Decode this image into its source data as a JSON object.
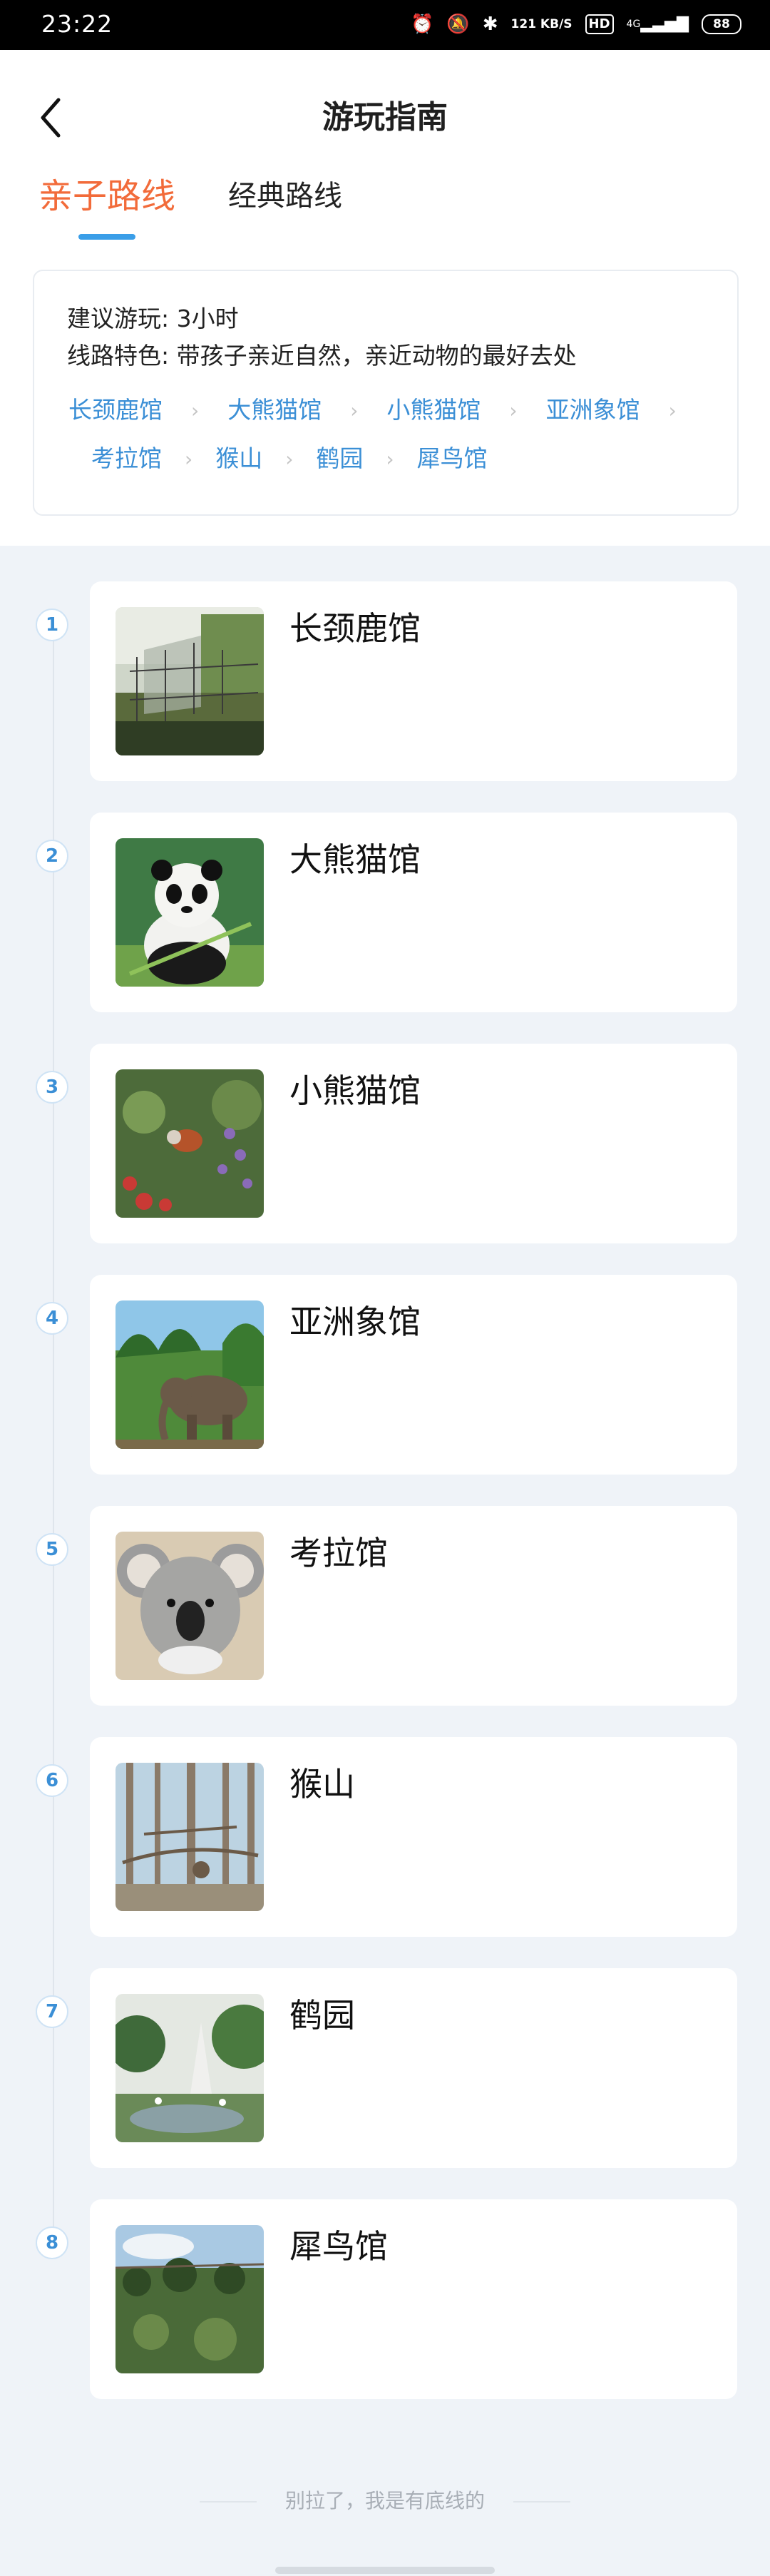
{
  "status_bar": {
    "time": "23:22",
    "network_speed": "121 KB/S",
    "hd": "HD",
    "network_type": "4G",
    "battery": "88"
  },
  "header": {
    "title": "游玩指南",
    "tabs": [
      {
        "label": "亲子路线",
        "active": true
      },
      {
        "label": "经典路线",
        "active": false
      }
    ]
  },
  "summary": {
    "duration": "建议游玩: 3小时",
    "feature": "线路特色: 带孩子亲近自然，亲近动物的最好去处",
    "route": [
      "长颈鹿馆",
      "大熊猫馆",
      "小熊猫馆",
      "亚洲象馆",
      "考拉馆",
      "猴山",
      "鹤园",
      "犀鸟馆"
    ]
  },
  "stops": [
    {
      "number": "1",
      "name": "长颈鹿馆",
      "image": "giraffe-enclosure"
    },
    {
      "number": "2",
      "name": "大熊猫馆",
      "image": "giant-panda"
    },
    {
      "number": "3",
      "name": "小熊猫馆",
      "image": "red-panda"
    },
    {
      "number": "4",
      "name": "亚洲象馆",
      "image": "asian-elephant"
    },
    {
      "number": "5",
      "name": "考拉馆",
      "image": "koala"
    },
    {
      "number": "6",
      "name": "猴山",
      "image": "monkey-hill"
    },
    {
      "number": "7",
      "name": "鹤园",
      "image": "crane-garden"
    },
    {
      "number": "8",
      "name": "犀鸟馆",
      "image": "hornbill-aviary"
    }
  ],
  "footer": {
    "text": "别拉了，我是有底线的"
  },
  "colors": {
    "accent_orange": "#f26b3a",
    "accent_blue": "#3b8fd6",
    "background": "#eff3f8"
  }
}
